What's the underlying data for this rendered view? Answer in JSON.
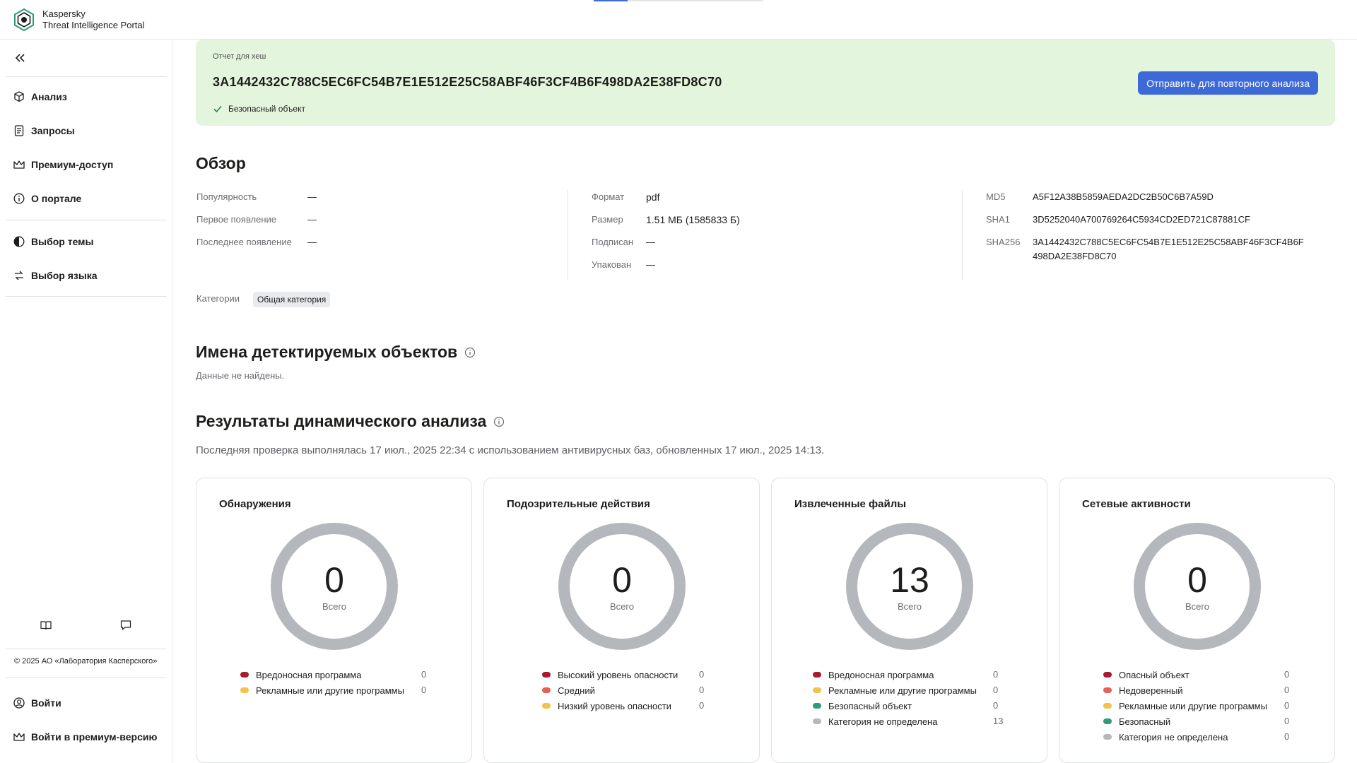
{
  "app": {
    "brand_line1": "Kaspersky",
    "brand_line2": "Threat Intelligence Portal"
  },
  "sidebar": {
    "nav": [
      {
        "label": "Анализ",
        "icon": "cube-icon"
      },
      {
        "label": "Запросы",
        "icon": "document-icon"
      },
      {
        "label": "Премиум-доступ",
        "icon": "crown-icon"
      },
      {
        "label": "О портале",
        "icon": "info-icon"
      }
    ],
    "settings": [
      {
        "label": "Выбор темы",
        "icon": "theme-icon"
      },
      {
        "label": "Выбор языка",
        "icon": "language-icon"
      }
    ],
    "copyright": "© 2025 АО «Лаборатория Касперского»",
    "login": "Войти",
    "premium_login": "Войти в премиум-версию"
  },
  "report": {
    "label": "Отчет для хеш",
    "hash": "3A1442432C788C5EC6FC54B7E1E512E25C58ABF46F3CF4B6F498DA2E38FD8C70",
    "status": "Безопасный объект",
    "reanalyze_button": "Отправить для повторного анализа",
    "status_color": "#e3f5dc",
    "accent_color": "#3d6ad6"
  },
  "overview": {
    "title": "Обзор",
    "col1": [
      {
        "key": "Популярность",
        "value": "—"
      },
      {
        "key": "Первое появление",
        "value": "—"
      },
      {
        "key": "Последнее появление",
        "value": "—"
      }
    ],
    "col2": [
      {
        "key": "Формат",
        "value": "pdf"
      },
      {
        "key": "Размер",
        "value": "1.51 МБ (1585833 Б)"
      },
      {
        "key": "Подписан",
        "value": "—"
      },
      {
        "key": "Упакован",
        "value": "—"
      }
    ],
    "col3": [
      {
        "key": "MD5",
        "value": "A5F12A38B5859AEDA2DC2B50C6B7A59D"
      },
      {
        "key": "SHA1",
        "value": "3D5252040A700769264C5934CD2ED721C87881CF"
      },
      {
        "key": "SHA256",
        "value_line1": "3A1442432C788C5EC6FC54B7E1E512E25C58ABF46F3CF4B6F",
        "value_line2": "498DA2E38FD8C70"
      }
    ],
    "categories_label": "Категории",
    "category_tag": "Общая категория"
  },
  "detections": {
    "title": "Имена детектируемых объектов",
    "empty": "Данные не найдены."
  },
  "dynamic": {
    "title": "Результаты динамического анализа",
    "scan_info": "Последняя проверка выполнялась 17 июл., 2025 22:34 с использованием антивирусных баз, обновленных 17 июл., 2025 14:13.",
    "cards": [
      {
        "title": "Обнаружения",
        "total": "0",
        "total_label": "Всего",
        "legend": [
          {
            "label": "Вредоносная программа",
            "count": "0",
            "color": "#a51c30"
          },
          {
            "label": "Рекламные или другие программы",
            "count": "0",
            "color": "#f2c14e"
          }
        ]
      },
      {
        "title": "Подозрительные действия",
        "total": "0",
        "total_label": "Всего",
        "legend": [
          {
            "label": "Высокий уровень опасности",
            "count": "0",
            "color": "#a51c30"
          },
          {
            "label": "Средний",
            "count": "0",
            "color": "#e8605a"
          },
          {
            "label": "Низкий уровень опасности",
            "count": "0",
            "color": "#f2c14e"
          }
        ]
      },
      {
        "title": "Извлеченные файлы",
        "total": "13",
        "total_label": "Всего",
        "legend": [
          {
            "label": "Вредоносная программа",
            "count": "0",
            "color": "#a51c30"
          },
          {
            "label": "Рекламные или другие программы",
            "count": "0",
            "color": "#f2c14e"
          },
          {
            "label": "Безопасный объект",
            "count": "0",
            "color": "#2e9c7c"
          },
          {
            "label": "Категория не определена",
            "count": "13",
            "color": "#b4b8bd"
          }
        ]
      },
      {
        "title": "Сетевые активности",
        "total": "0",
        "total_label": "Всего",
        "legend": [
          {
            "label": "Опасный объект",
            "count": "0",
            "color": "#a51c30"
          },
          {
            "label": "Недоверенный",
            "count": "0",
            "color": "#e8605a"
          },
          {
            "label": "Рекламные или другие программы",
            "count": "0",
            "color": "#f2c14e"
          },
          {
            "label": "Безопасный",
            "count": "0",
            "color": "#2e9c7c"
          },
          {
            "label": "Категория не определена",
            "count": "0",
            "color": "#b4b8bd"
          }
        ]
      }
    ]
  }
}
